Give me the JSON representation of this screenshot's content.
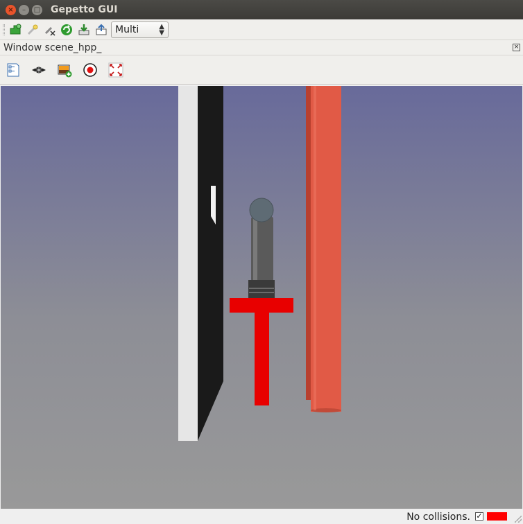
{
  "window": {
    "title": "Gepetto GUI"
  },
  "toolbar": {
    "mode_select": "Multi"
  },
  "dock": {
    "title": "Window scene_hpp_"
  },
  "status": {
    "collision_text": "No collisions.",
    "collision_check_glyph": "✓",
    "collision_color": "#ff0000"
  },
  "icons": {
    "window_buttons": [
      "close-icon",
      "minimize-icon",
      "maximize-icon"
    ],
    "toolbar": [
      "add-robot-icon",
      "add-environment-icon",
      "remove-icon",
      "refresh-icon",
      "save-icon",
      "open-icon"
    ],
    "view": [
      "camera-info-icon",
      "grid-icon",
      "screenshot-icon",
      "record-icon",
      "fullscreen-icon"
    ]
  },
  "scene_colors": {
    "background_top": "#686a9a",
    "background_bottom": "#999999",
    "wall": "#e6e6e6",
    "wall_shadow": "#1a1a1a",
    "pipe": "#e15a46",
    "robot_arm": "#5a5a5a",
    "gripper": "#e80000"
  }
}
